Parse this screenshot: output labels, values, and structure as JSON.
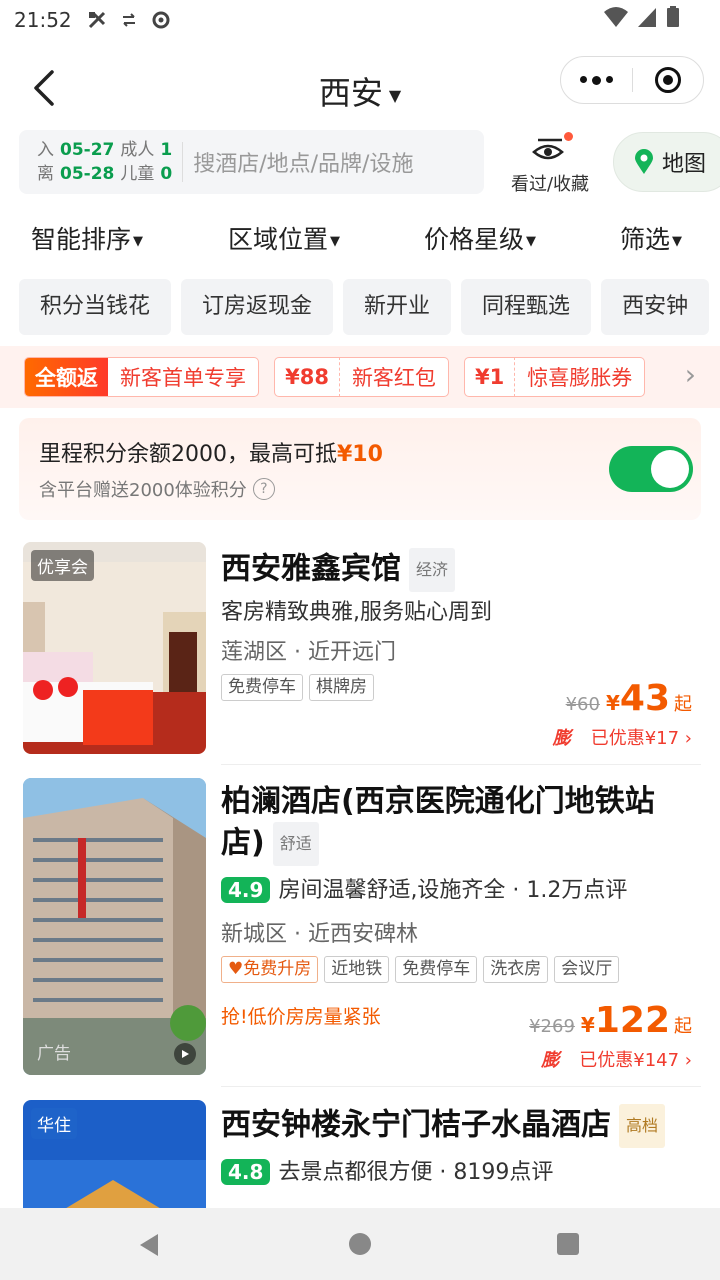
{
  "status_bar": {
    "time": "21:52"
  },
  "nav": {
    "title": "西安"
  },
  "search": {
    "checkin_label": "入",
    "checkin_date": "05-27",
    "checkout_label": "离",
    "checkout_date": "05-28",
    "adult_label": "成人",
    "adult_count": "1",
    "child_label": "儿童",
    "child_count": "0",
    "placeholder": "搜酒店/地点/品牌/设施",
    "viewed_label": "看过/收藏",
    "map_label": "地图"
  },
  "sort": {
    "items": [
      "智能排序",
      "区域位置",
      "价格星级",
      "筛选"
    ]
  },
  "chips": [
    "积分当钱花",
    "订房返现金",
    "新开业",
    "同程甄选",
    "西安钟"
  ],
  "coupons": [
    {
      "head": "全额返",
      "body": "新客首单专享"
    },
    {
      "head": "¥88",
      "body": "新客红包"
    },
    {
      "head": "¥1",
      "body": "惊喜膨胀券"
    }
  ],
  "points": {
    "line1_prefix": "里程积分余额2000，最高可抵",
    "line1_amount": "¥10",
    "line2": "含平台赠送2000体验积分",
    "toggle_on": true
  },
  "hotels": [
    {
      "photo_tag": "优享会",
      "name": "西安雅鑫宾馆",
      "grade": "经济",
      "desc": "客房精致典雅,服务贴心周到",
      "location": "莲湖区 · 近开远门",
      "tags": [
        "免费停车",
        "棋牌房"
      ],
      "old_price": "¥60",
      "currency": "¥",
      "price": "43",
      "price_suffix": "起",
      "boom": "膨",
      "discount": "已优惠¥17"
    },
    {
      "photo_tag": "广告",
      "name": "柏澜酒店(西京医院通化门地铁站店)",
      "grade": "舒适",
      "score": "4.9",
      "review": "房间温馨舒适,设施齐全 · 1.2万点评",
      "location": "新城区 · 近西安碑林",
      "tags": [
        "免费升房",
        "近地铁",
        "免费停车",
        "洗衣房",
        "会议厅"
      ],
      "urgent": "抢!低价房房量紧张",
      "old_price": "¥269",
      "currency": "¥",
      "price": "122",
      "price_suffix": "起",
      "boom": "膨",
      "discount": "已优惠¥147"
    },
    {
      "photo_tag": "华住",
      "name": "西安钟楼永宁门桔子水晶酒店",
      "grade": "高档",
      "score": "4.8",
      "review": "去景点都很方便 · 8199点评"
    }
  ],
  "colors": {
    "brand_green": "#13b458",
    "price_orange": "#f35a00",
    "coupon_red": "#f03c2f"
  }
}
